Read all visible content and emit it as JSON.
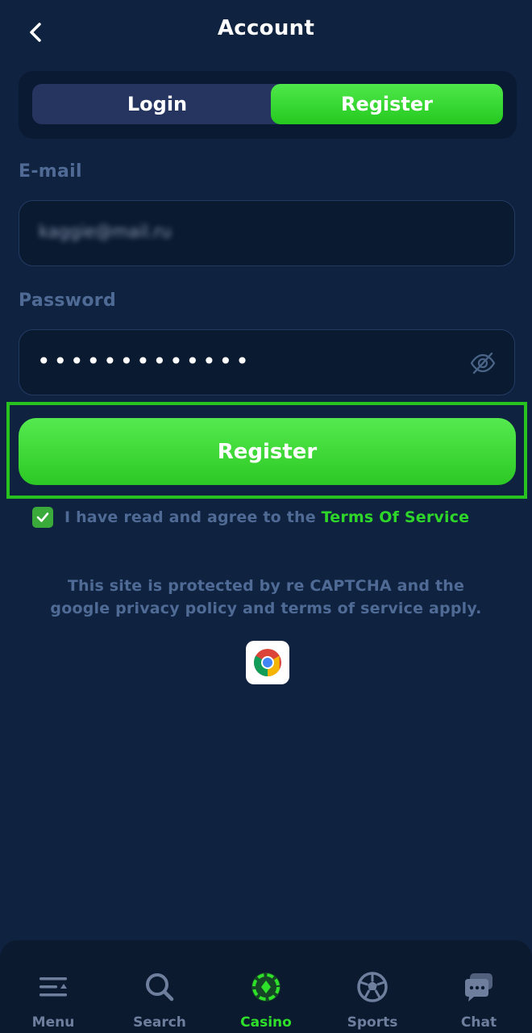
{
  "header": {
    "title": "Account"
  },
  "tabs": [
    {
      "label": "Login",
      "active": false
    },
    {
      "label": "Register",
      "active": true
    }
  ],
  "form": {
    "email_label": "E-mail",
    "email_value": "kaggie@mail.ru",
    "password_label": "Password",
    "password_mask": "•••••••••••••",
    "submit_label": "Register"
  },
  "agreement": {
    "checked": true,
    "text": "I have read and agree to the ",
    "link": "Terms Of Service"
  },
  "captcha": {
    "line1": "This site is protected by re CAPTCHA and the",
    "line2": "google privacy policy and terms of service apply."
  },
  "bottom_nav": [
    {
      "label": "Menu",
      "icon": "menu-icon",
      "active": false
    },
    {
      "label": "Search",
      "icon": "search-icon",
      "active": false
    },
    {
      "label": "Casino",
      "icon": "casino-chip-icon",
      "active": true
    },
    {
      "label": "Sports",
      "icon": "soccer-ball-icon",
      "active": false
    },
    {
      "label": "Chat",
      "icon": "chat-icon",
      "active": false
    }
  ],
  "colors": {
    "background": "#0f2240",
    "accent_green": "#2fd62a",
    "muted_text": "#4f6b95"
  }
}
